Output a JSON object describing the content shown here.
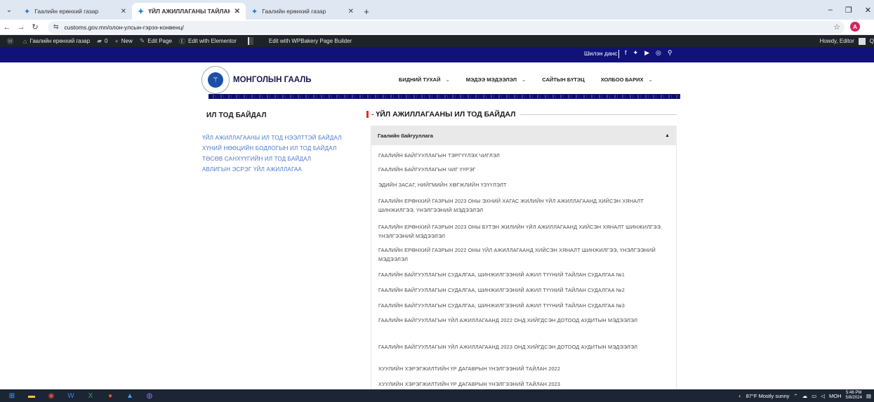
{
  "browser": {
    "tabs": [
      {
        "title": "Гаалийн ерөнхий газар",
        "active": false
      },
      {
        "title": "ҮЙЛ АЖИЛЛАГАНЫ ТАЙЛАН",
        "active": true
      },
      {
        "title": "Гаалийн ерөнхий газар",
        "active": false
      }
    ],
    "url_site_icon": "⇆",
    "url": "customs.gov.mn/олон-улсын-гэрээ-конвенц/"
  },
  "wp_admin": {
    "site_name": "Гаалийн ерөнхий газар",
    "comments": "0",
    "new": "New",
    "edit_page": "Edit Page",
    "edit_elementor": "Edit with Elementor",
    "edit_wpbakery": "Edit with WPBakery Page Builder",
    "howdy": "Howdy, Editor"
  },
  "site": {
    "account": "Шилэн данс",
    "logo_text": "МОНГОЛЫН ГААЛЬ",
    "nav": [
      "БИДНИЙ ТУХАЙ",
      "МЭДЭЭ МЭДЭЭЛЭЛ",
      "САЙТЫН БҮТЭЦ",
      "ХОЛБОО БАРИХ"
    ],
    "nav_has_chevron": [
      true,
      true,
      false,
      true
    ]
  },
  "sidebar": {
    "title": "ИЛ ТОД БАЙДАЛ",
    "items": [
      "ҮЙЛ АЖИЛЛАГААНЫ ИЛ ТОД НЭЭЛТТЭЙ БАЙДАЛ",
      "ХҮНИЙ НӨӨЦИЙН БОДЛОГЫН ИЛ ТОД БАЙДАЛ",
      "ТӨСӨВ САНХҮҮГИЙН ИЛ ТОД БАЙДАЛ",
      "АВЛИГЫН ЭСРЭГ ҮЙЛ АЖИЛЛАГАА"
    ]
  },
  "main": {
    "title": "ҮЙЛ АЖИЛЛАГААНЫ ИЛ ТОД БАЙДАЛ",
    "accordion_title": "Гаалийн байгууллага",
    "documents": [
      "ГААЛИЙН БАЙГУУЛЛАГЫН ТЭРГҮҮЛЭХ ЧИГЛЭЛ",
      "ГААЛИЙН БАЙГУУЛЛАГЫН ЧИГ ҮҮРЭГ",
      "ЭДИЙН ЗАСАГ, НИЙГМИЙН ХӨГЖЛИЙН ҮЗҮҮЛЭЛТ",
      "ГААЛИЙН ЕРӨНХИЙ ГАЗРЫН 2023 ОНЫ ЭХНИЙ ХАГАС ЖИЛИЙН ҮЙЛ АЖИЛЛАГААНД ХИЙСЭН ХЯНАЛТ ШИНЖИЛГЭЭ, ҮНЭЛГЭЭНИЙ МЭДЭЭЛЭЛ",
      "ГААЛИЙН ЕРӨНХИЙ ГАЗРЫН 2023 ОНЫ БҮТЭН ЖИЛИЙН ҮЙЛ АЖИЛЛАГААНД ХИЙСЭН ХЯНАЛТ ШИНЖИЛГЭЭ, ҮНЭЛГЭЭНИЙ МЭДЭЭЛЭЛ",
      "ГААЛИЙН ЕРӨНХИЙ ГАЗРЫН 2022 ОНЫ ҮЙЛ АЖИЛЛАГААНД ХИЙСЭН ХЯНАЛТ ШИНЖИЛГЭЭ, ҮНЭЛГЭЭНИЙ МЭДЭЭЛЭЛ",
      "ГААЛИЙН БАЙГУУЛЛАГЫН СУДАЛГАА, ШИНЖИЛГЭЭНИЙ АЖИЛ ТҮҮНИЙ ТАЙЛАН СУДАЛГАА №1",
      "ГААЛИЙН БАЙГУУЛЛАГЫН СУДАЛГАА, ШИНЖИЛГЭЭНИЙ АЖИЛ ТҮҮНИЙ ТАЙЛАН СУДАЛГАА №2",
      "ГААЛИЙН БАЙГУУЛЛАГЫН СУДАЛГАА, ШИНЖИЛГЭЭНИЙ АЖИЛ ТҮҮНИЙ ТАЙЛАН СУДАЛГАА №3",
      "ГААЛИЙН БАЙГУУЛЛАГЫН ҮЙЛ АЖИЛЛАГААНД 2022 ОНД ХИЙГДСЭН ДОТООД АУДИТЫН МЭДЭЭЛЭЛ",
      "ГААЛИЙН БАЙГУУЛЛАГЫН ҮЙЛ АЖИЛЛАГААНД 2023 ОНД ХИЙГДСЭН ДОТООД АУДИТЫН МЭДЭЭЛЭЛ",
      "ХУУЛИЙН ХЭРЭГЖИЛТИЙН ҮР ДАГАВРЫН ҮНЭЛГЭЭНИЙ ТАЙЛАН 2022",
      "ХУУЛИЙН ХЭРЭГЖИЛТИЙН ҮР ДАГАВРЫН ҮНЭЛГЭЭНИЙ ТАЙЛАН 2023"
    ]
  },
  "taskbar": {
    "weather": "87°F  Mostly sunny",
    "lang": "МОН",
    "time": "5:46 PM",
    "date": "5/8/2024"
  }
}
